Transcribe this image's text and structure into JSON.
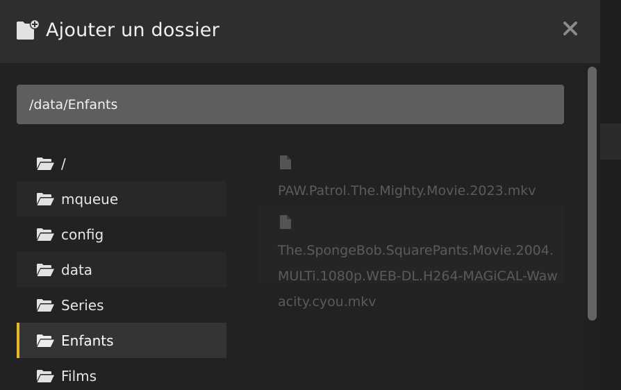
{
  "dialog": {
    "title": "Ajouter un dossier",
    "close_label": "×",
    "header_icon": "folder-plus-icon"
  },
  "path_input": {
    "value": "/data/Enfants"
  },
  "folders": [
    {
      "label": "/",
      "icon": "folder-open-icon",
      "selected": false
    },
    {
      "label": "mqueue",
      "icon": "folder-open-icon",
      "selected": false
    },
    {
      "label": "config",
      "icon": "folder-open-icon",
      "selected": false
    },
    {
      "label": "data",
      "icon": "folder-open-icon",
      "selected": false
    },
    {
      "label": "Series",
      "icon": "folder-open-icon",
      "selected": false
    },
    {
      "label": "Enfants",
      "icon": "folder-open-icon",
      "selected": true
    },
    {
      "label": "Films",
      "icon": "folder-open-icon",
      "selected": false
    }
  ],
  "files": [
    {
      "name": "PAW.Patrol.The.Mighty.Movie.2023.mkv",
      "icon": "file-icon"
    },
    {
      "name": "The.SpongeBob.SquarePants.Movie.2004.MULTi.1080p.WEB-DL.H264-MAGiCAL-Wawacity.cyou.mkv",
      "icon": "file-icon"
    }
  ],
  "colors": {
    "accent": "#e6b82b",
    "dialog_bg": "#222222",
    "header_bg": "#2e2e2e",
    "input_bg": "#5e5e5e"
  }
}
